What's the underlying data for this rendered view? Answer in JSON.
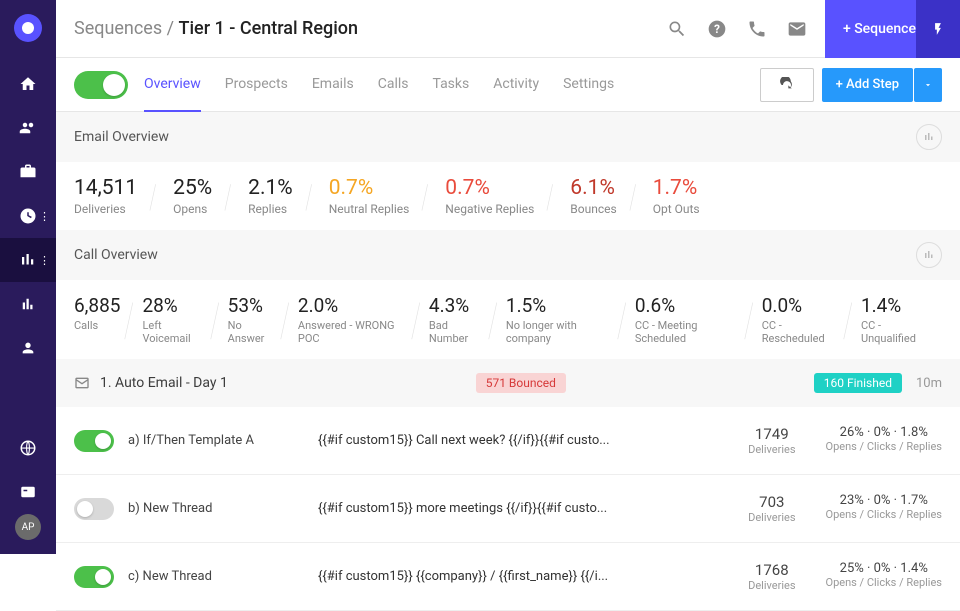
{
  "breadcrumb": {
    "parent": "Sequences",
    "sep": " / ",
    "current": "Tier 1 - Central Region"
  },
  "header": {
    "seqBtn": "+ Sequence"
  },
  "tabs": [
    "Overview",
    "Prospects",
    "Emails",
    "Calls",
    "Tasks",
    "Activity",
    "Settings"
  ],
  "addStep": "+ Add Step",
  "avatar": "AP",
  "emailOverview": {
    "title": "Email Overview",
    "stats": [
      {
        "v": "14,511",
        "l": "Deliveries",
        "c": ""
      },
      {
        "v": "25%",
        "l": "Opens",
        "c": ""
      },
      {
        "v": "2.1%",
        "l": "Replies",
        "c": ""
      },
      {
        "v": "0.7%",
        "l": "Neutral Replies",
        "c": "orange"
      },
      {
        "v": "0.7%",
        "l": "Negative Replies",
        "c": "red"
      },
      {
        "v": "6.1%",
        "l": "Bounces",
        "c": "darkred"
      },
      {
        "v": "1.7%",
        "l": "Opt Outs",
        "c": "red"
      }
    ]
  },
  "callOverview": {
    "title": "Call Overview",
    "stats": [
      {
        "v": "6,885",
        "l": "Calls"
      },
      {
        "v": "28%",
        "l": "Left Voicemail"
      },
      {
        "v": "53%",
        "l": "No Answer"
      },
      {
        "v": "2.0%",
        "l": "Answered - WRONG POC"
      },
      {
        "v": "4.3%",
        "l": "Bad Number"
      },
      {
        "v": "1.5%",
        "l": "No longer with company"
      },
      {
        "v": "0.6%",
        "l": "CC - Meeting Scheduled"
      },
      {
        "v": "0.0%",
        "l": "CC - Rescheduled"
      },
      {
        "v": "1.4%",
        "l": "CC - Unqualified"
      }
    ]
  },
  "step": {
    "title": "1. Auto Email - Day 1",
    "bounced": "571 Bounced",
    "finished": "160 Finished",
    "time": "10m"
  },
  "rows": [
    {
      "on": true,
      "label": "a) If/Then Template A",
      "snippet": "{{#if custom15}} Call next week? {{/if}}{{#if custo...",
      "del": "1749",
      "line": "26%  ·  0%  ·  1.8%"
    },
    {
      "on": false,
      "label": "b) New Thread",
      "snippet": "{{#if custom15}} more meetings {{/if}}{{#if custo...",
      "del": "703",
      "line": "23%  ·  0%  ·  1.7%"
    },
    {
      "on": true,
      "label": "c) New Thread",
      "snippet": "{{#if custom15}} {{company}} / {{first_name}} {{/i...",
      "del": "1768",
      "line": "25%  ·  0%  ·  1.4%"
    }
  ],
  "labels": {
    "deliveries": "Deliveries",
    "ocr": "Opens / Clicks / Replies"
  }
}
